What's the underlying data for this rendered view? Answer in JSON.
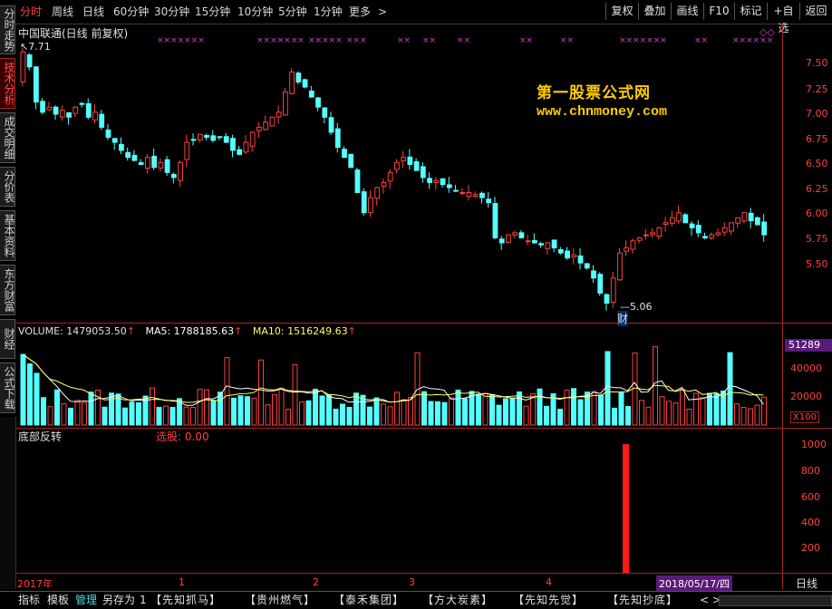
{
  "toolbar": {
    "periods": [
      "分时",
      "周线",
      "日线",
      "60分钟",
      "30分钟",
      "15分钟",
      "10分钟",
      "5分钟",
      "1分钟",
      "更多"
    ],
    "more_arrow": ">",
    "right_buttons": [
      "复权",
      "叠加",
      "画线",
      "F10",
      "标记",
      "+自选",
      "返回"
    ]
  },
  "side_tabs": [
    "分时走势",
    "技术分析",
    "成交明细",
    "分价表",
    "基本资料",
    "东方财富",
    "财经",
    "公式下载"
  ],
  "main_chart": {
    "title": "中国联通(日线 前复权)",
    "high_label": "7.71",
    "low_label": "5.06",
    "marker_char": "财",
    "watermark_line1": "第一股票公式网",
    "watermark_line2": "www.chnmoney.com",
    "y_ticks": [
      "7.50",
      "7.25",
      "7.00",
      "6.75",
      "6.50",
      "6.25",
      "6.00",
      "5.75",
      "5.50"
    ],
    "x_marks_row": "×××××××"
  },
  "volume_panel": {
    "volume_label": "VOLUME: 1479053.50",
    "ma5_label": "MA5: 1788185.63",
    "ma10_label": "MA10: 1516249.63",
    "current_value": "51289",
    "y_ticks": [
      "40000",
      "20000"
    ],
    "unit": "X100"
  },
  "indicator_panel": {
    "name": "底部反转",
    "signal_label": "选股: 0.00",
    "y_ticks": [
      "1000",
      "800",
      "600",
      "400",
      "200"
    ]
  },
  "date_axis": {
    "labels": [
      "2017年",
      "1",
      "2",
      "3",
      "4"
    ],
    "cursor_date": "2018/05/17/四",
    "period": "日线"
  },
  "bottom_bar": {
    "tabs": [
      "指标",
      "模板",
      "管理",
      "另存为",
      "1"
    ],
    "formulas": [
      "【先知抓马】",
      "【贵州燃气】",
      "【泰禾集团】",
      "【方大炭素】",
      "【先知先觉】",
      "【先知抄底】"
    ],
    "arrows": "< >"
  },
  "chart_data": [
    {
      "type": "candlestick",
      "title": "中国联通(日线 前复权)",
      "ylim": [
        5.06,
        7.71
      ],
      "y_ticks": [
        7.5,
        7.25,
        7.0,
        6.75,
        6.5,
        6.25,
        6.0,
        5.75,
        5.5
      ],
      "high": 7.71,
      "low": 5.06,
      "close_series": [
        7.6,
        7.45,
        7.1,
        7.0,
        7.05,
        6.98,
        7.02,
        6.95,
        7.05,
        7.08,
        6.95,
        7.0,
        6.85,
        6.75,
        6.7,
        6.62,
        6.55,
        6.52,
        6.48,
        6.55,
        6.45,
        6.5,
        6.4,
        6.35,
        6.5,
        6.7,
        6.72,
        6.78,
        6.75,
        6.72,
        6.75,
        6.7,
        6.62,
        6.58,
        6.7,
        6.8,
        6.85,
        6.9,
        6.95,
        7.0,
        7.2,
        7.4,
        7.3,
        7.25,
        7.15,
        7.05,
        6.95,
        6.8,
        6.65,
        6.55,
        6.45,
        6.2,
        6.0,
        6.15,
        6.25,
        6.3,
        6.4,
        6.5,
        6.55,
        6.48,
        6.42,
        6.35,
        6.3,
        6.32,
        6.28,
        6.25,
        6.22,
        6.2,
        6.2,
        6.18,
        6.15,
        6.1,
        5.75,
        5.7,
        5.78,
        5.8,
        5.75,
        5.72,
        5.7,
        5.68,
        5.7,
        5.65,
        5.6,
        5.55,
        5.58,
        5.5,
        5.45,
        5.35,
        5.2,
        5.1,
        5.35,
        5.6,
        5.65,
        5.72,
        5.75,
        5.78,
        5.8,
        5.85,
        5.9,
        5.95,
        6.0,
        5.9,
        5.85,
        5.8,
        5.75,
        5.78,
        5.8,
        5.85,
        5.9,
        5.95,
        6.0,
        5.92,
        5.88,
        5.78
      ]
    },
    {
      "type": "bar",
      "title": "VOLUME",
      "series": [
        {
          "name": "VOLUME",
          "values": [
            1479053.5
          ]
        },
        {
          "name": "MA5",
          "values": [
            1788185.63
          ]
        },
        {
          "name": "MA10",
          "values": [
            1516249.63
          ]
        }
      ],
      "y_ticks": [
        40000,
        20000
      ],
      "unit": "X100"
    },
    {
      "type": "bar",
      "title": "底部反转",
      "y_ticks": [
        1000,
        800,
        600,
        400,
        200
      ],
      "signal_value": 1000,
      "signal_date": "2018/05/17"
    }
  ]
}
